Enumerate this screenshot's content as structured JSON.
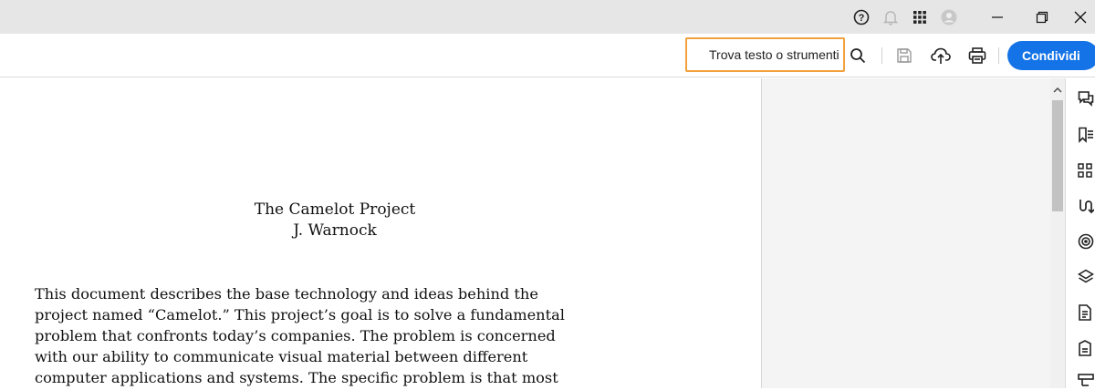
{
  "titlebar": {
    "help_icon": "help-circle-icon",
    "notifications_icon": "bell-icon",
    "apps_icon": "app-grid-icon",
    "account_icon": "user-avatar-icon",
    "minimize_icon": "minimize-icon",
    "restore_icon": "restore-icon",
    "close_icon": "close-icon"
  },
  "toolbar": {
    "search_value": "Trova testo o strumenti",
    "search_icon": "magnifier-icon",
    "save_icon": "save-icon",
    "upload_icon": "cloud-upload-icon",
    "print_icon": "printer-icon",
    "share_label": "Condividi"
  },
  "document": {
    "title": "The Camelot Project",
    "author": "J. Warnock",
    "paragraph_lines": [
      "This document describes the base technology and ideas behind the",
      "project named “Camelot.” This project’s goal is to solve a fundamental",
      "problem that confronts today’s companies. The problem is concerned",
      "with our ability to communicate visual material between different",
      "computer applications and systems. The specific problem is that most"
    ]
  },
  "right_rail": {
    "icons": [
      "comment-icon",
      "bookmark-list-icon",
      "thumbnails-grid-icon",
      "link-icon",
      "target-icon",
      "layers-icon",
      "document-icon",
      "form-document-icon",
      "structure-icon"
    ]
  },
  "colors": {
    "accent_blue": "#1473e6",
    "search_focus_border": "#f2a03c",
    "titlebar_bg": "#e6e6e6",
    "panel_bg": "#f4f4f4"
  }
}
